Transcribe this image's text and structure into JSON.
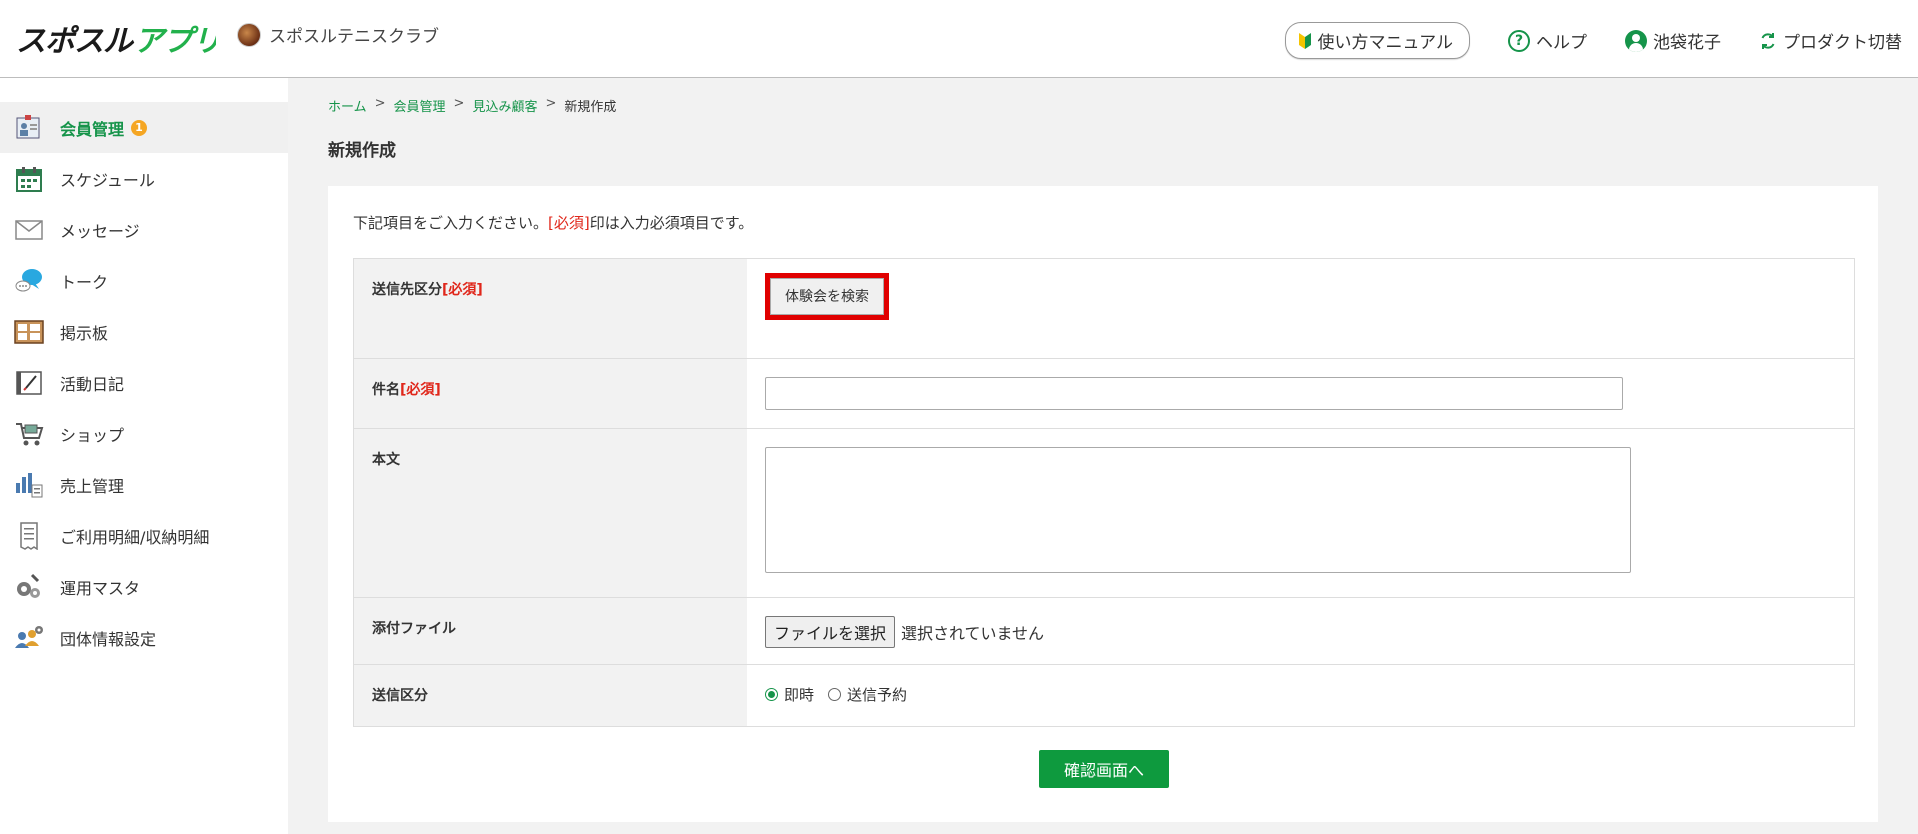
{
  "header": {
    "logo_text": "スポスルアプリ",
    "club_name": "スポスルテニスクラブ",
    "manual_label": "使い方マニュアル",
    "help_label": "ヘルプ",
    "user_name": "池袋花子",
    "product_switch_label": "プロダクト切替"
  },
  "sidebar": {
    "items": [
      {
        "label": "会員管理",
        "icon": "members-icon",
        "badge": "1"
      },
      {
        "label": "スケジュール",
        "icon": "calendar-icon"
      },
      {
        "label": "メッセージ",
        "icon": "envelope-icon"
      },
      {
        "label": "トーク",
        "icon": "chat-icon"
      },
      {
        "label": "掲示板",
        "icon": "bulletin-board-icon"
      },
      {
        "label": "活動日記",
        "icon": "diary-icon"
      },
      {
        "label": "ショップ",
        "icon": "cart-icon"
      },
      {
        "label": "売上管理",
        "icon": "sales-icon"
      },
      {
        "label": "ご利用明細/収納明細",
        "icon": "receipt-icon"
      },
      {
        "label": "運用マスタ",
        "icon": "gears-icon"
      },
      {
        "label": "団体情報設定",
        "icon": "group-settings-icon"
      }
    ]
  },
  "breadcrumb": {
    "home": "ホーム",
    "members": "会員管理",
    "prospects": "見込み顧客",
    "current": "新規作成",
    "separator": ">"
  },
  "page_title": "新規作成",
  "form": {
    "intro_before": "下記項目をご入力ください。",
    "intro_required": "[必須]",
    "intro_after": "印は入力必須項目です。",
    "required_mark": "[必須]",
    "recipient_label": "送信先区分",
    "search_button": "体験会を検索",
    "subject_label": "件名",
    "subject_value": "",
    "body_label": "本文",
    "body_value": "",
    "attachment_label": "添付ファイル",
    "file_button": "ファイルを選択",
    "file_status": "選択されていません",
    "send_type_label": "送信区分",
    "send_options": [
      {
        "label": "即時",
        "checked": true
      },
      {
        "label": "送信予約",
        "checked": false
      }
    ],
    "confirm_button": "確認画面へ"
  },
  "colors": {
    "accent_green": "#16944a",
    "button_green": "#0e9a3e",
    "required_red": "#e0271b",
    "highlight_red": "#e00000",
    "badge_orange": "#f5a623"
  }
}
